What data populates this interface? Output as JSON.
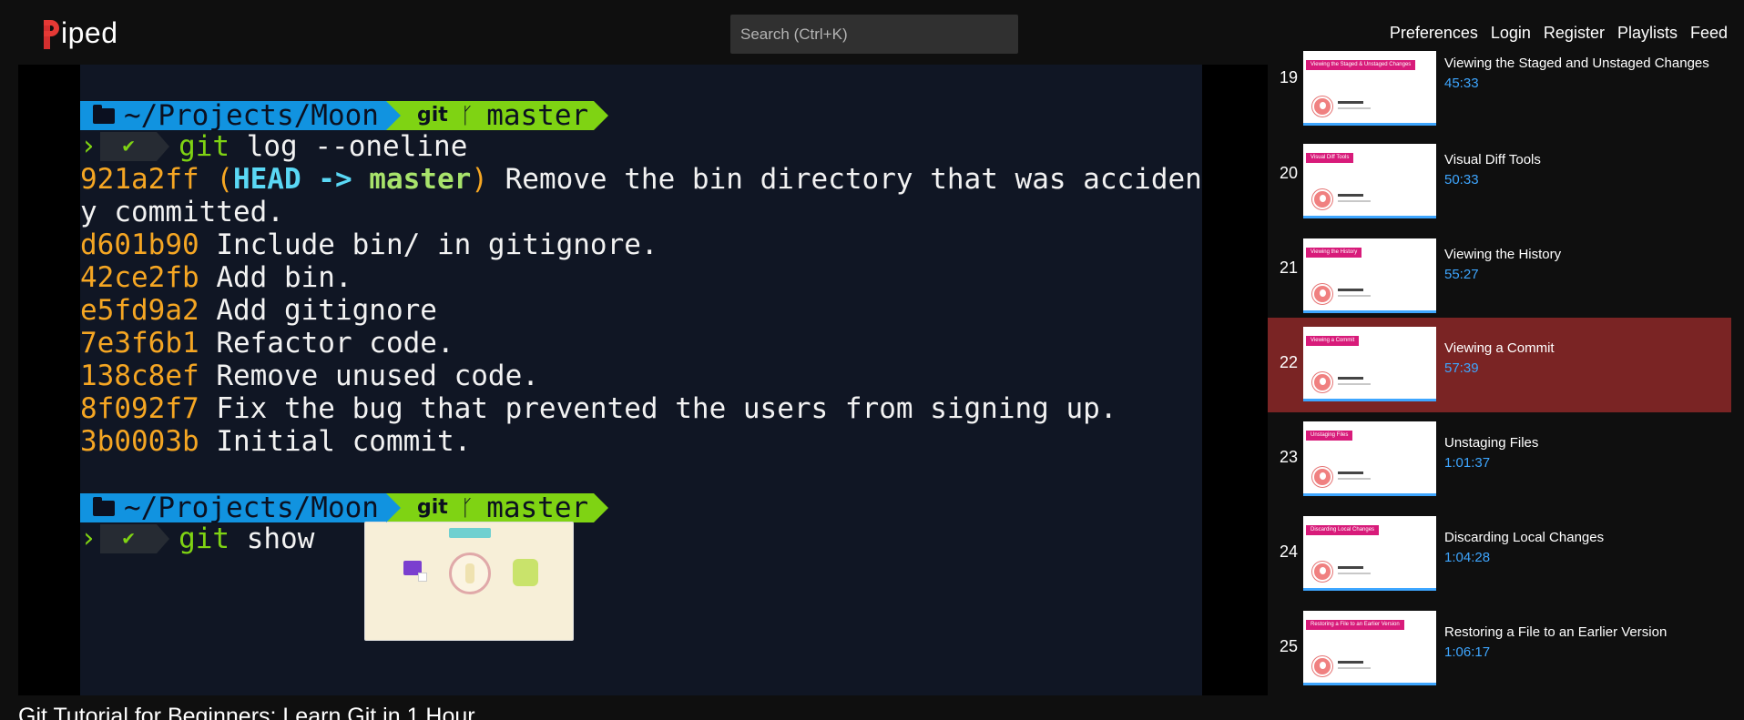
{
  "nav": {
    "logo_text": "iped",
    "search_placeholder": "Search (Ctrl+K)",
    "links": [
      "Preferences",
      "Login",
      "Register",
      "Playlists",
      "Feed"
    ]
  },
  "terminal": {
    "prompt_path": "~/Projects/Moon",
    "prompt_git": "git",
    "prompt_branch": "master",
    "cmd1_git": "git",
    "cmd1_rest": " log --oneline",
    "log": [
      {
        "hash": "921a2ff",
        "msg": " Remove the bin directory that was accidental"
      },
      {
        "hash": "",
        "msg": "y committed."
      },
      {
        "hash": "d601b90",
        "msg": " Include bin/ in gitignore."
      },
      {
        "hash": "42ce2fb",
        "msg": " Add bin."
      },
      {
        "hash": "e5fd9a2",
        "msg": " Add gitignore"
      },
      {
        "hash": "7e3f6b1",
        "msg": " Refactor code."
      },
      {
        "hash": "138c8ef",
        "msg": " Remove unused code."
      },
      {
        "hash": "8f092f7",
        "msg": " Fix the bug that prevented the users from signing up."
      },
      {
        "hash": "3b0003b",
        "msg": " Initial commit."
      }
    ],
    "head_open": " (",
    "head_label": "HEAD -> ",
    "head_branch": "master",
    "head_close": ")",
    "cmd2_git": "git",
    "cmd2_rest": " show"
  },
  "video": {
    "title": "Git Tutorial for Beginners: Learn Git in 1 Hour"
  },
  "playlist": [
    {
      "num": "19",
      "title": "Viewing the Staged and Unstaged Changes",
      "duration": "45:33",
      "thumb_label": "Viewing the Staged & Unstaged Changes",
      "active": false
    },
    {
      "num": "20",
      "title": "Visual Diff Tools",
      "duration": "50:33",
      "thumb_label": "Visual Diff Tools",
      "active": false
    },
    {
      "num": "21",
      "title": "Viewing the History",
      "duration": "55:27",
      "thumb_label": "Viewing the History",
      "active": false
    },
    {
      "num": "22",
      "title": "Viewing a Commit",
      "duration": "57:39",
      "thumb_label": "Viewing a Commit",
      "active": true
    },
    {
      "num": "23",
      "title": "Unstaging Files",
      "duration": "1:01:37",
      "thumb_label": "Unstaging Files",
      "active": false
    },
    {
      "num": "24",
      "title": "Discarding Local Changes",
      "duration": "1:04:28",
      "thumb_label": "Discarding Local Changes",
      "active": false
    },
    {
      "num": "25",
      "title": "Restoring a File to an Earlier Version",
      "duration": "1:06:17",
      "thumb_label": "Restoring a File to an Earlier Version",
      "active": false
    }
  ],
  "colors": {
    "accent": "#3ea6ff",
    "active_row": "#7a2424",
    "logo_red": "#e53935"
  }
}
